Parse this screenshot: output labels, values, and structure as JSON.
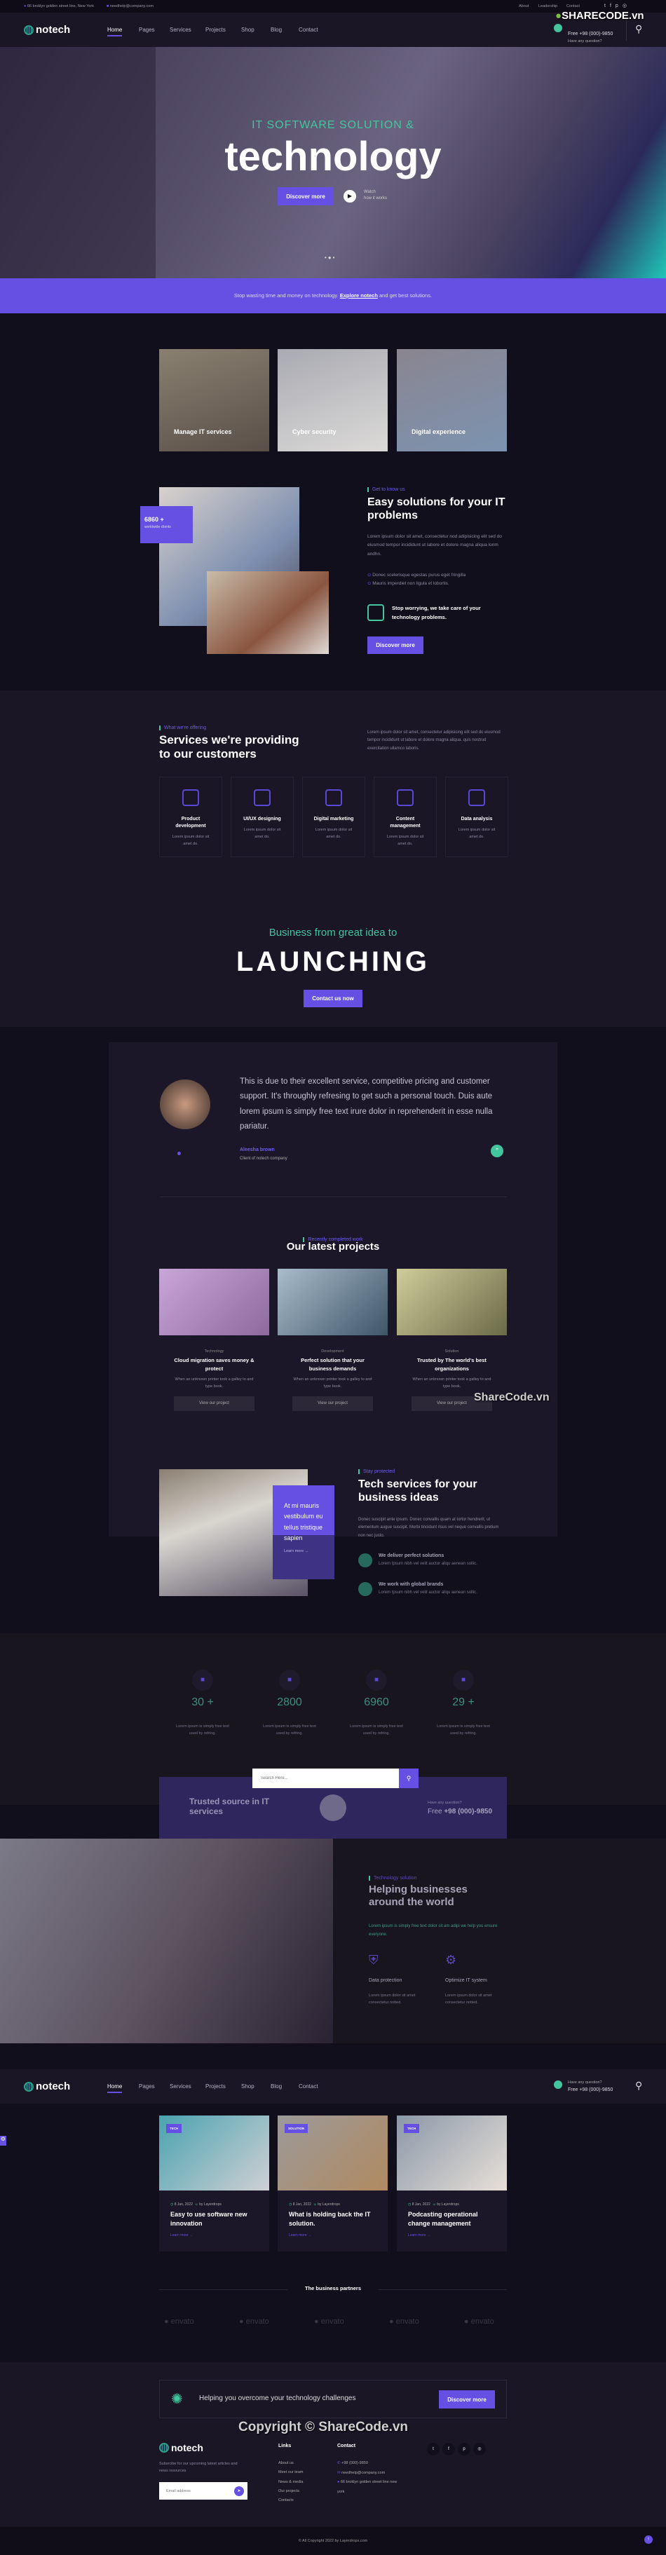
{
  "topbar": {
    "address": "66 broklyn golden street line, New York",
    "email": "needhelp@company.com",
    "links": [
      "About",
      "Leadership",
      "Contact"
    ],
    "social": [
      "twitter-icon",
      "facebook-icon",
      "pinterest-icon",
      "instagram-icon"
    ]
  },
  "header": {
    "logo": "notech",
    "nav": [
      "Home",
      "Pages",
      "Services",
      "Projects",
      "Shop",
      "Blog",
      "Contact"
    ],
    "question": "Have any question?",
    "phone": "Free +98 (000)-9850"
  },
  "watermark": {
    "logo": "SHARECODE.vn",
    "mid": "ShareCode.vn",
    "footer": "Copyright © ShareCode.vn"
  },
  "hero": {
    "subtitle": "IT SOFTWARE SOLUTION &",
    "title": "technology",
    "button": "Discover more",
    "watch": "Watch",
    "watch2": "how it works"
  },
  "band": {
    "text": "Stop wasting time and money on technology.",
    "link": "Explore notech",
    "text2": "and get best solutions."
  },
  "features": [
    "Manage IT services",
    "Cyber security",
    "Digital experience"
  ],
  "about": {
    "badge_num": "6860 +",
    "badge_label": "worldwide clients",
    "tag": "Get to know us",
    "title": "Easy solutions for your IT problems",
    "text": "Lorem ipsum dolor sit amet, consectetur nod adipisicing elit sed do eiusmod tempor incididunt ut labore et dolore magna aliqua lonm andhn.",
    "list": [
      "Donec scelerisque egestas purus eget fringilla",
      "Mauris imperdiet non ligula et lobortis."
    ],
    "highlight": "Stop worrying, we take care of your technology problems.",
    "button": "Discover more"
  },
  "services": {
    "tag": "What we're offering",
    "title": "Services we're providing to our customers",
    "text": "Lorem ipsum dolor sit amet, consectetur adipisicing elit sed do eiusmod tempor incididunt ut labore et dolore magna aliqua. quis nostrud exercitation ullamco laboris.",
    "items": [
      {
        "title": "Product development",
        "text": "Lorem ipsum dolor sit amet do."
      },
      {
        "title": "UI/UX designing",
        "text": "Lorem ipsum dolor sit amet do."
      },
      {
        "title": "Digital marketing",
        "text": "Lorem ipsum dolor sit amet do."
      },
      {
        "title": "Content management",
        "text": "Lorem ipsum dolor sit amet do."
      },
      {
        "title": "Data analysis",
        "text": "Lorem ipsum dolor sit amet do."
      }
    ]
  },
  "launch": {
    "subtitle": "Business from great idea to",
    "title": "LAUNCHING",
    "button": "Contact us now"
  },
  "testimonial": {
    "text": "This is due to their excellent service, competitive pricing and customer support. It's throughly refresing to get such a personal touch. Duis aute lorem ipsum is simply free text irure dolor in reprehenderit in esse nulla pariatur.",
    "name": "Aleesha brown",
    "role": "Client of notech company"
  },
  "projects": {
    "tag": "Recently completed work",
    "title": "Our latest projects",
    "items": [
      {
        "cat": "Technology",
        "title": "Cloud migration saves money & protect",
        "text": "When an unknown printer took a galley to and type book.",
        "button": "View our project"
      },
      {
        "cat": "Development",
        "title": "Perfect solution that your business demands",
        "text": "When an unknown printer took a galley to and type book.",
        "button": "View our project"
      },
      {
        "cat": "Solution",
        "title": "Trusted by The world's best organizations",
        "text": "When an unknown printer took a galley to and type book.",
        "button": "View our project"
      }
    ]
  },
  "tech": {
    "box": "At mi mauris vestibulum eu tellus tristique sapien",
    "box_link": "Learn more →",
    "tag": "Stay protected",
    "title": "Tech services for your business ideas",
    "text": "Donec suscipit ante ipsum. Donec convallis quam at tortor hendrerit, ut elementum augue suscipit. Morbi tincidunt risus vel neque convallis pretium non nec justo.",
    "items": [
      {
        "title": "We deliver perfect solutions",
        "text": "Lorem Ipsum nibh vel velit auctor aliqu aenean sollic."
      },
      {
        "title": "We work with global brands",
        "text": "Lorem Ipsum nibh vel velit auctor aliqu aenean sollic."
      }
    ]
  },
  "stats": [
    {
      "num": "30 +",
      "text": "Lorem ipsum is simply free text used by refring."
    },
    {
      "num": "2800",
      "text": "Lorem ipsum is simply free text used by refring."
    },
    {
      "num": "6960",
      "text": "Lorem ipsum is simply free text used by refring."
    },
    {
      "num": "29 +",
      "text": "Lorem ipsum is simply free text used by refring."
    }
  ],
  "search": {
    "placeholder": "Search Here..."
  },
  "cta": {
    "title": "Trusted source in IT services",
    "question": "Have any question?",
    "phone_prefix": "Free",
    "phone": "+98 (000)-9850"
  },
  "helping": {
    "tag": "Technology solution",
    "title": "Helping businesses around the world",
    "text": "Lorem ipsum is simply free text dolor sit am adipi we help you ensure everyone.",
    "items": [
      {
        "title": "Data protection",
        "text": "Lorem ipsum dolor sit amet consectetur notted."
      },
      {
        "title": "Optimize IT system",
        "text": "Lorem ipsum dolor sit amet consectetur notted."
      }
    ]
  },
  "blog": [
    {
      "tag": "TECH",
      "date": "8 Jan, 2022",
      "author": "by Layerdrops",
      "title": "Easy to use software new innovation",
      "link": "Learn more →"
    },
    {
      "tag": "SOLUTION",
      "date": "8 Jan, 2022",
      "author": "by Layerdrops",
      "title": "What is holding back the IT solution.",
      "link": "Learn more →"
    },
    {
      "tag": "TECH",
      "date": "8 Jan, 2022",
      "author": "by Layerdrops",
      "title": "Podcasting operational change management",
      "link": "Learn more →"
    }
  ],
  "partners": {
    "title": "The business partners",
    "logos": [
      "envato",
      "envato",
      "envato",
      "envato",
      "envato"
    ]
  },
  "footer": {
    "cta": "Helping you overcome your technology challenges",
    "cta_button": "Discover more",
    "logo": "notech",
    "subscribe": "Subsrcibe for our upcoming latest articles and news resources",
    "email_placeholder": "Email address",
    "links_title": "Links",
    "links": [
      "About us",
      "Meet our team",
      "News & media",
      "Our projects",
      "Contacts"
    ],
    "contact_title": "Contact",
    "phone": "+98 (000)-9850",
    "email": "needhelp@company.com",
    "address": "66 broklyn golden street line new york",
    "copyright": "© All Copyright 2022 by Layerdrops.com"
  },
  "colors": {
    "accent": "#6650e3",
    "teal": "#43c59e",
    "bg": "#120f1c"
  }
}
